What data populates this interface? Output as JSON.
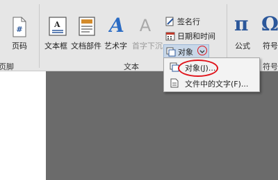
{
  "ribbon": {
    "header_footer": {
      "page_number": "页码",
      "group": "页脚"
    },
    "text_group": {
      "text_box": "文本框",
      "quick_parts": "文档部件",
      "wordart": "艺术字",
      "drop_cap": "首字下沉",
      "signature_line": "签名行",
      "date_time": "日期和时间",
      "object": "对象",
      "group": "文本"
    },
    "symbols_group": {
      "equation": "公式",
      "symbol": "符号",
      "group": "符号",
      "equation_glyph": "π",
      "symbol_glyph": "Ω"
    },
    "page_number_glyph": "#",
    "wordart_glyph": "A",
    "drop_cap_glyph": "A"
  },
  "object_menu": {
    "items": [
      {
        "label": "对象(J)...",
        "icon": "object-icon",
        "highlighted": true
      },
      {
        "label": "文件中的文字(F)...",
        "icon": "text-from-file-icon"
      }
    ]
  },
  "colors": {
    "ribbon_bg": "#e6e6e6",
    "canvas_bg": "#6b6b6b",
    "annotation_red": "#e0141b",
    "accent_blue": "#2b579a"
  }
}
